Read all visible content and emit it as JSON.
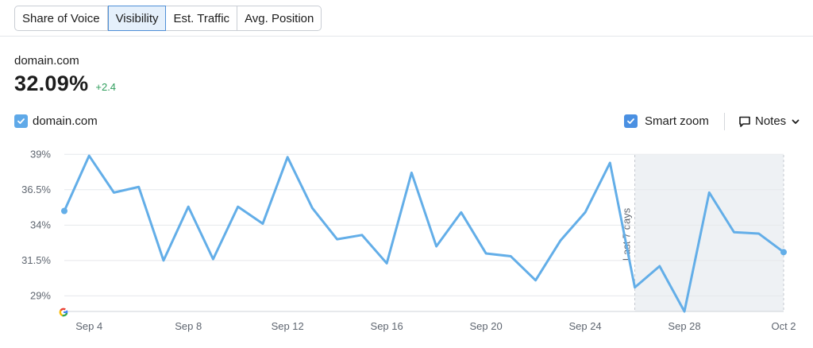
{
  "tabs": [
    {
      "label": "Share of Voice",
      "active": false
    },
    {
      "label": "Visibility",
      "active": true
    },
    {
      "label": "Est. Traffic",
      "active": false
    },
    {
      "label": "Avg. Position",
      "active": false
    }
  ],
  "summary": {
    "domain": "domain.com",
    "value": "32.09%",
    "delta": "+2.4"
  },
  "legend": {
    "series_label": "domain.com",
    "checked": true
  },
  "controls": {
    "smart_zoom_label": "Smart zoom",
    "smart_zoom_checked": true,
    "notes_label": "Notes"
  },
  "colors": {
    "series": "#63aee8",
    "accent": "#4a90e2",
    "delta_positive": "#2f9e5c",
    "highlight_band": "#eef1f4"
  },
  "icons": [
    "checkbox-checked-icon",
    "note-icon",
    "chevron-down-icon",
    "google-icon"
  ],
  "chart_data": {
    "type": "line",
    "ylabel": "",
    "xlabel": "",
    "y_ticks": [
      "39%",
      "36.5%",
      "34%",
      "31.5%",
      "29%"
    ],
    "y_tick_values": [
      39,
      36.5,
      34,
      31.5,
      29
    ],
    "ylim": [
      27.9,
      39.8
    ],
    "x_ticks": [
      "Sep 4",
      "Sep 8",
      "Sep 12",
      "Sep 16",
      "Sep 20",
      "Sep 24",
      "Sep 28",
      "Oct 2"
    ],
    "x_tick_days": [
      4,
      8,
      12,
      16,
      20,
      24,
      28,
      32
    ],
    "xlim": [
      3,
      32
    ],
    "grid": true,
    "highlight": {
      "label": "Last 7 days",
      "from_day": 26,
      "to_day": 32
    },
    "series": [
      {
        "name": "domain.com",
        "x": [
          3,
          4,
          5,
          6,
          7,
          8,
          9,
          10,
          11,
          12,
          13,
          14,
          15,
          16,
          17,
          18,
          19,
          20,
          21,
          22,
          23,
          24,
          25,
          26,
          27,
          28,
          29,
          30,
          31,
          32
        ],
        "values": [
          35.0,
          38.9,
          36.3,
          36.7,
          31.5,
          35.3,
          31.6,
          35.3,
          34.1,
          38.8,
          35.2,
          33.0,
          33.3,
          31.3,
          37.7,
          32.5,
          34.9,
          32.0,
          31.8,
          30.1,
          32.9,
          34.9,
          38.4,
          29.6,
          31.1,
          27.9,
          36.3,
          33.5,
          33.4,
          32.09
        ]
      }
    ]
  }
}
